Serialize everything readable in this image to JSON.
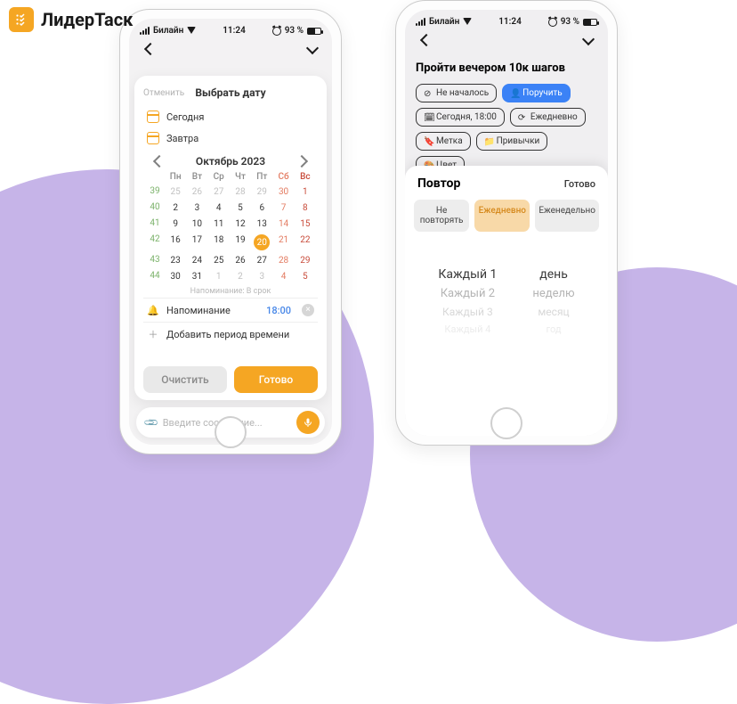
{
  "brand": {
    "title": "ЛидерТаск"
  },
  "status": {
    "carrier": "Билайн",
    "time": "11:24",
    "battery": "93 %"
  },
  "phone1": {
    "cancel": "Отменить",
    "title": "Выбрать дату",
    "today": "Сегодня",
    "tomorrow": "Завтра",
    "month": "Октябрь 2023",
    "dow": [
      "Пн",
      "Вт",
      "Ср",
      "Чт",
      "Пт",
      "Сб",
      "Вс"
    ],
    "weeks": [
      {
        "wk": "39",
        "d": [
          "25",
          "26",
          "27",
          "28",
          "29",
          "30",
          "1"
        ]
      },
      {
        "wk": "40",
        "d": [
          "2",
          "3",
          "4",
          "5",
          "6",
          "7",
          "8"
        ]
      },
      {
        "wk": "41",
        "d": [
          "9",
          "10",
          "11",
          "12",
          "13",
          "14",
          "15"
        ]
      },
      {
        "wk": "42",
        "d": [
          "16",
          "17",
          "18",
          "19",
          "20",
          "21",
          "22"
        ]
      },
      {
        "wk": "43",
        "d": [
          "23",
          "24",
          "25",
          "26",
          "27",
          "28",
          "29"
        ]
      },
      {
        "wk": "44",
        "d": [
          "30",
          "31",
          "1",
          "2",
          "3",
          "4",
          "5"
        ]
      }
    ],
    "hint": "Напоминание: В срок",
    "reminder_label": "Напоминание",
    "reminder_time": "18:00",
    "add_period": "Добавить период времени",
    "clear": "Очистить",
    "done": "Готово",
    "msg_placeholder": "Введите сообщение..."
  },
  "phone2": {
    "task_title": "Пройти вечером 10к шагов",
    "chips": {
      "status": "Не началось",
      "assign": "Поручить",
      "date": "Сегодня, 18:00",
      "repeat": "Ежедневно",
      "tag": "Метка",
      "habits": "Привычки",
      "color": "Цвет"
    },
    "sheet": {
      "title": "Повтор",
      "done": "Готово",
      "seg": [
        "Не повторять",
        "Ежедневно",
        "Еженедельно"
      ],
      "wheel_left": [
        "Каждый 1",
        "Каждый 2",
        "Каждый 3",
        "Каждый 4"
      ],
      "wheel_right": [
        "день",
        "неделю",
        "месяц",
        "год"
      ]
    }
  }
}
